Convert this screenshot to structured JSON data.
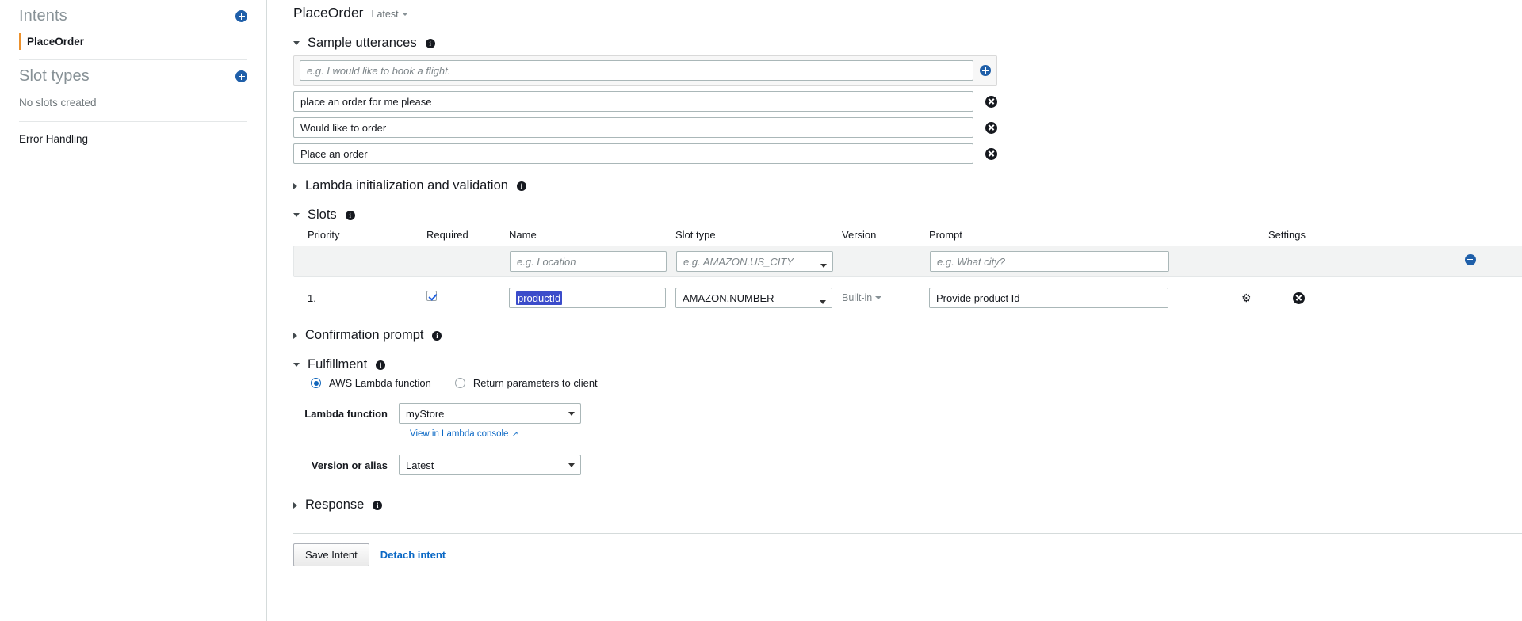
{
  "sidebar": {
    "intents_header": "Intents",
    "intents_add_icon": "plus-circle-icon",
    "intent_items": [
      {
        "label": "PlaceOrder",
        "selected": true
      }
    ],
    "slot_types_header": "Slot types",
    "slot_types_add_icon": "plus-circle-icon",
    "slot_types_empty": "No slots created",
    "error_handling": "Error Handling"
  },
  "header": {
    "intent_name": "PlaceOrder",
    "version": "Latest",
    "version_caret_icon": "chevron-down-icon"
  },
  "sections": {
    "sample_utterances": {
      "title": "Sample utterances",
      "expanded": true,
      "info_icon": "info-icon",
      "new_placeholder": "e.g. I would like to book a flight.",
      "add_icon": "plus-circle-icon",
      "items": [
        {
          "value": "place an order for me please",
          "delete_icon": "remove-circle-icon"
        },
        {
          "value": "Would like to order",
          "delete_icon": "remove-circle-icon"
        },
        {
          "value": "Place an order",
          "delete_icon": "remove-circle-icon"
        }
      ]
    },
    "lambda_init": {
      "title": "Lambda initialization and validation",
      "expanded": false,
      "info_icon": "info-icon"
    },
    "slots": {
      "title": "Slots",
      "expanded": true,
      "info_icon": "info-icon",
      "columns": [
        "Priority",
        "Required",
        "Name",
        "Slot type",
        "Version",
        "Prompt",
        "Settings"
      ],
      "new_row": {
        "name_placeholder": "e.g. Location",
        "slot_type_placeholder": "e.g. AMAZON.US_CITY",
        "prompt_placeholder": "e.g. What city?",
        "add_icon": "plus-circle-icon"
      },
      "rows": [
        {
          "priority": "1.",
          "required": true,
          "name": "productId",
          "name_selected": true,
          "slot_type": "AMAZON.NUMBER",
          "version": "Built-in",
          "version_caret_icon": "chevron-down-icon",
          "prompt": "Provide product Id",
          "settings_icon": "gear-icon",
          "delete_icon": "remove-circle-icon"
        }
      ]
    },
    "confirmation_prompt": {
      "title": "Confirmation prompt",
      "expanded": false,
      "info_icon": "info-icon"
    },
    "fulfillment": {
      "title": "Fulfillment",
      "expanded": true,
      "info_icon": "info-icon",
      "options": [
        {
          "label": "AWS Lambda function",
          "selected": true
        },
        {
          "label": "Return parameters to client",
          "selected": false
        }
      ],
      "lambda_function_label": "Lambda function",
      "lambda_function_value": "myStore",
      "lambda_console_link": "View in Lambda console",
      "lambda_console_icon": "external-link-icon",
      "version_alias_label": "Version or alias",
      "version_alias_value": "Latest"
    },
    "response": {
      "title": "Response",
      "expanded": false,
      "info_icon": "info-icon"
    }
  },
  "footer": {
    "save_label": "Save Intent",
    "detach_label": "Detach intent"
  },
  "colors": {
    "accent_orange": "#ec912d",
    "link_blue": "#0a68c5",
    "add_blue": "#1f5fa9",
    "selection_blue": "#3b4cca"
  }
}
